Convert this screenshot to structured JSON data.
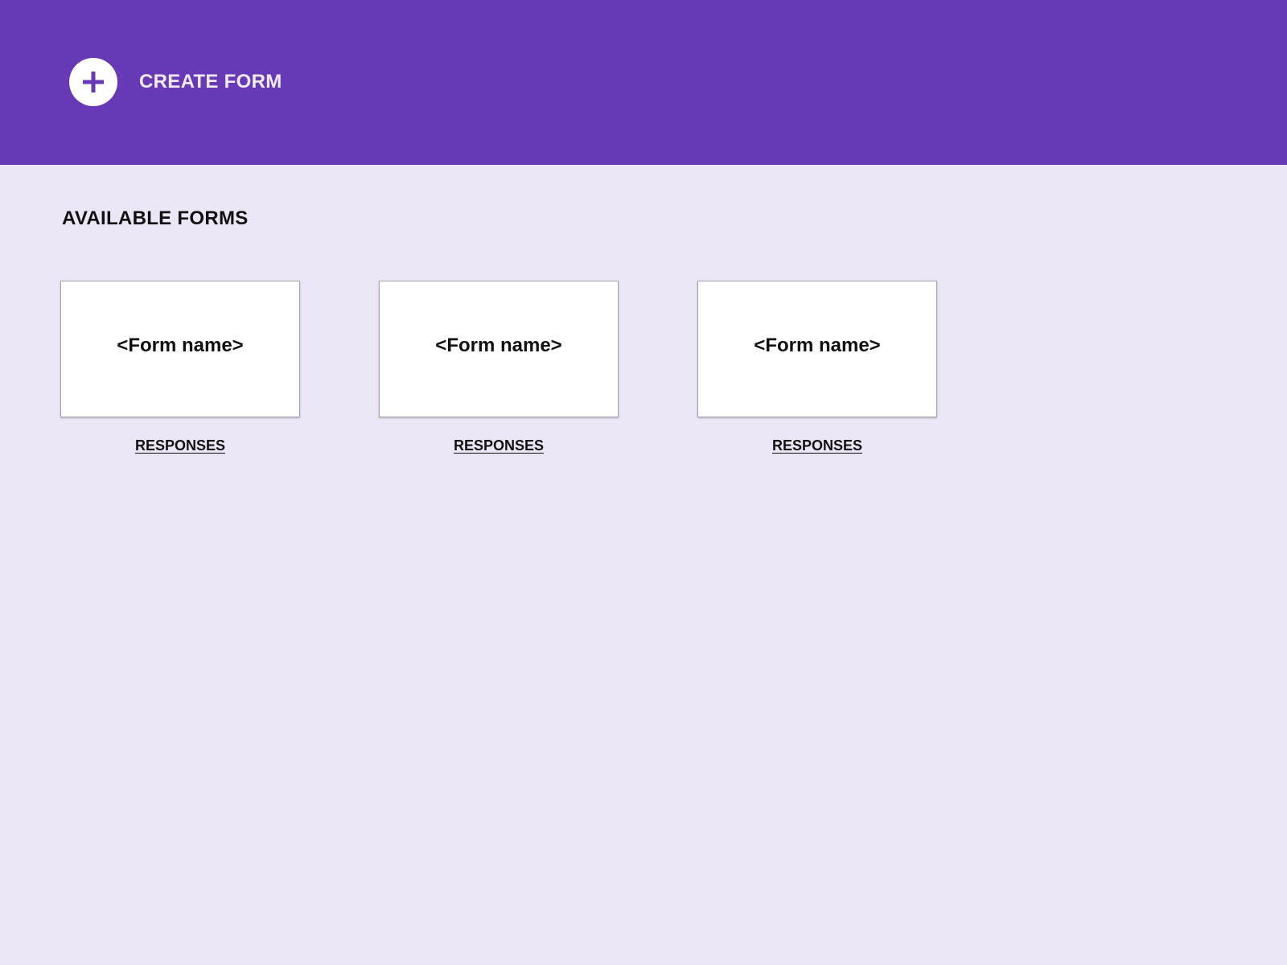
{
  "colors": {
    "header_background": "#6839b7",
    "page_background": "#ede6f6",
    "card_background": "#ffffff",
    "text": "#111111",
    "header_text": "#f1ecfb"
  },
  "header": {
    "create_icon": "plus-icon",
    "create_label": "CREATE FORM"
  },
  "main": {
    "section_title": "AVAILABLE FORMS",
    "forms": [
      {
        "name": "<Form name>",
        "link_label": "RESPONSES"
      },
      {
        "name": "<Form name>",
        "link_label": "RESPONSES"
      },
      {
        "name": "<Form name>",
        "link_label": "RESPONSES"
      }
    ]
  }
}
